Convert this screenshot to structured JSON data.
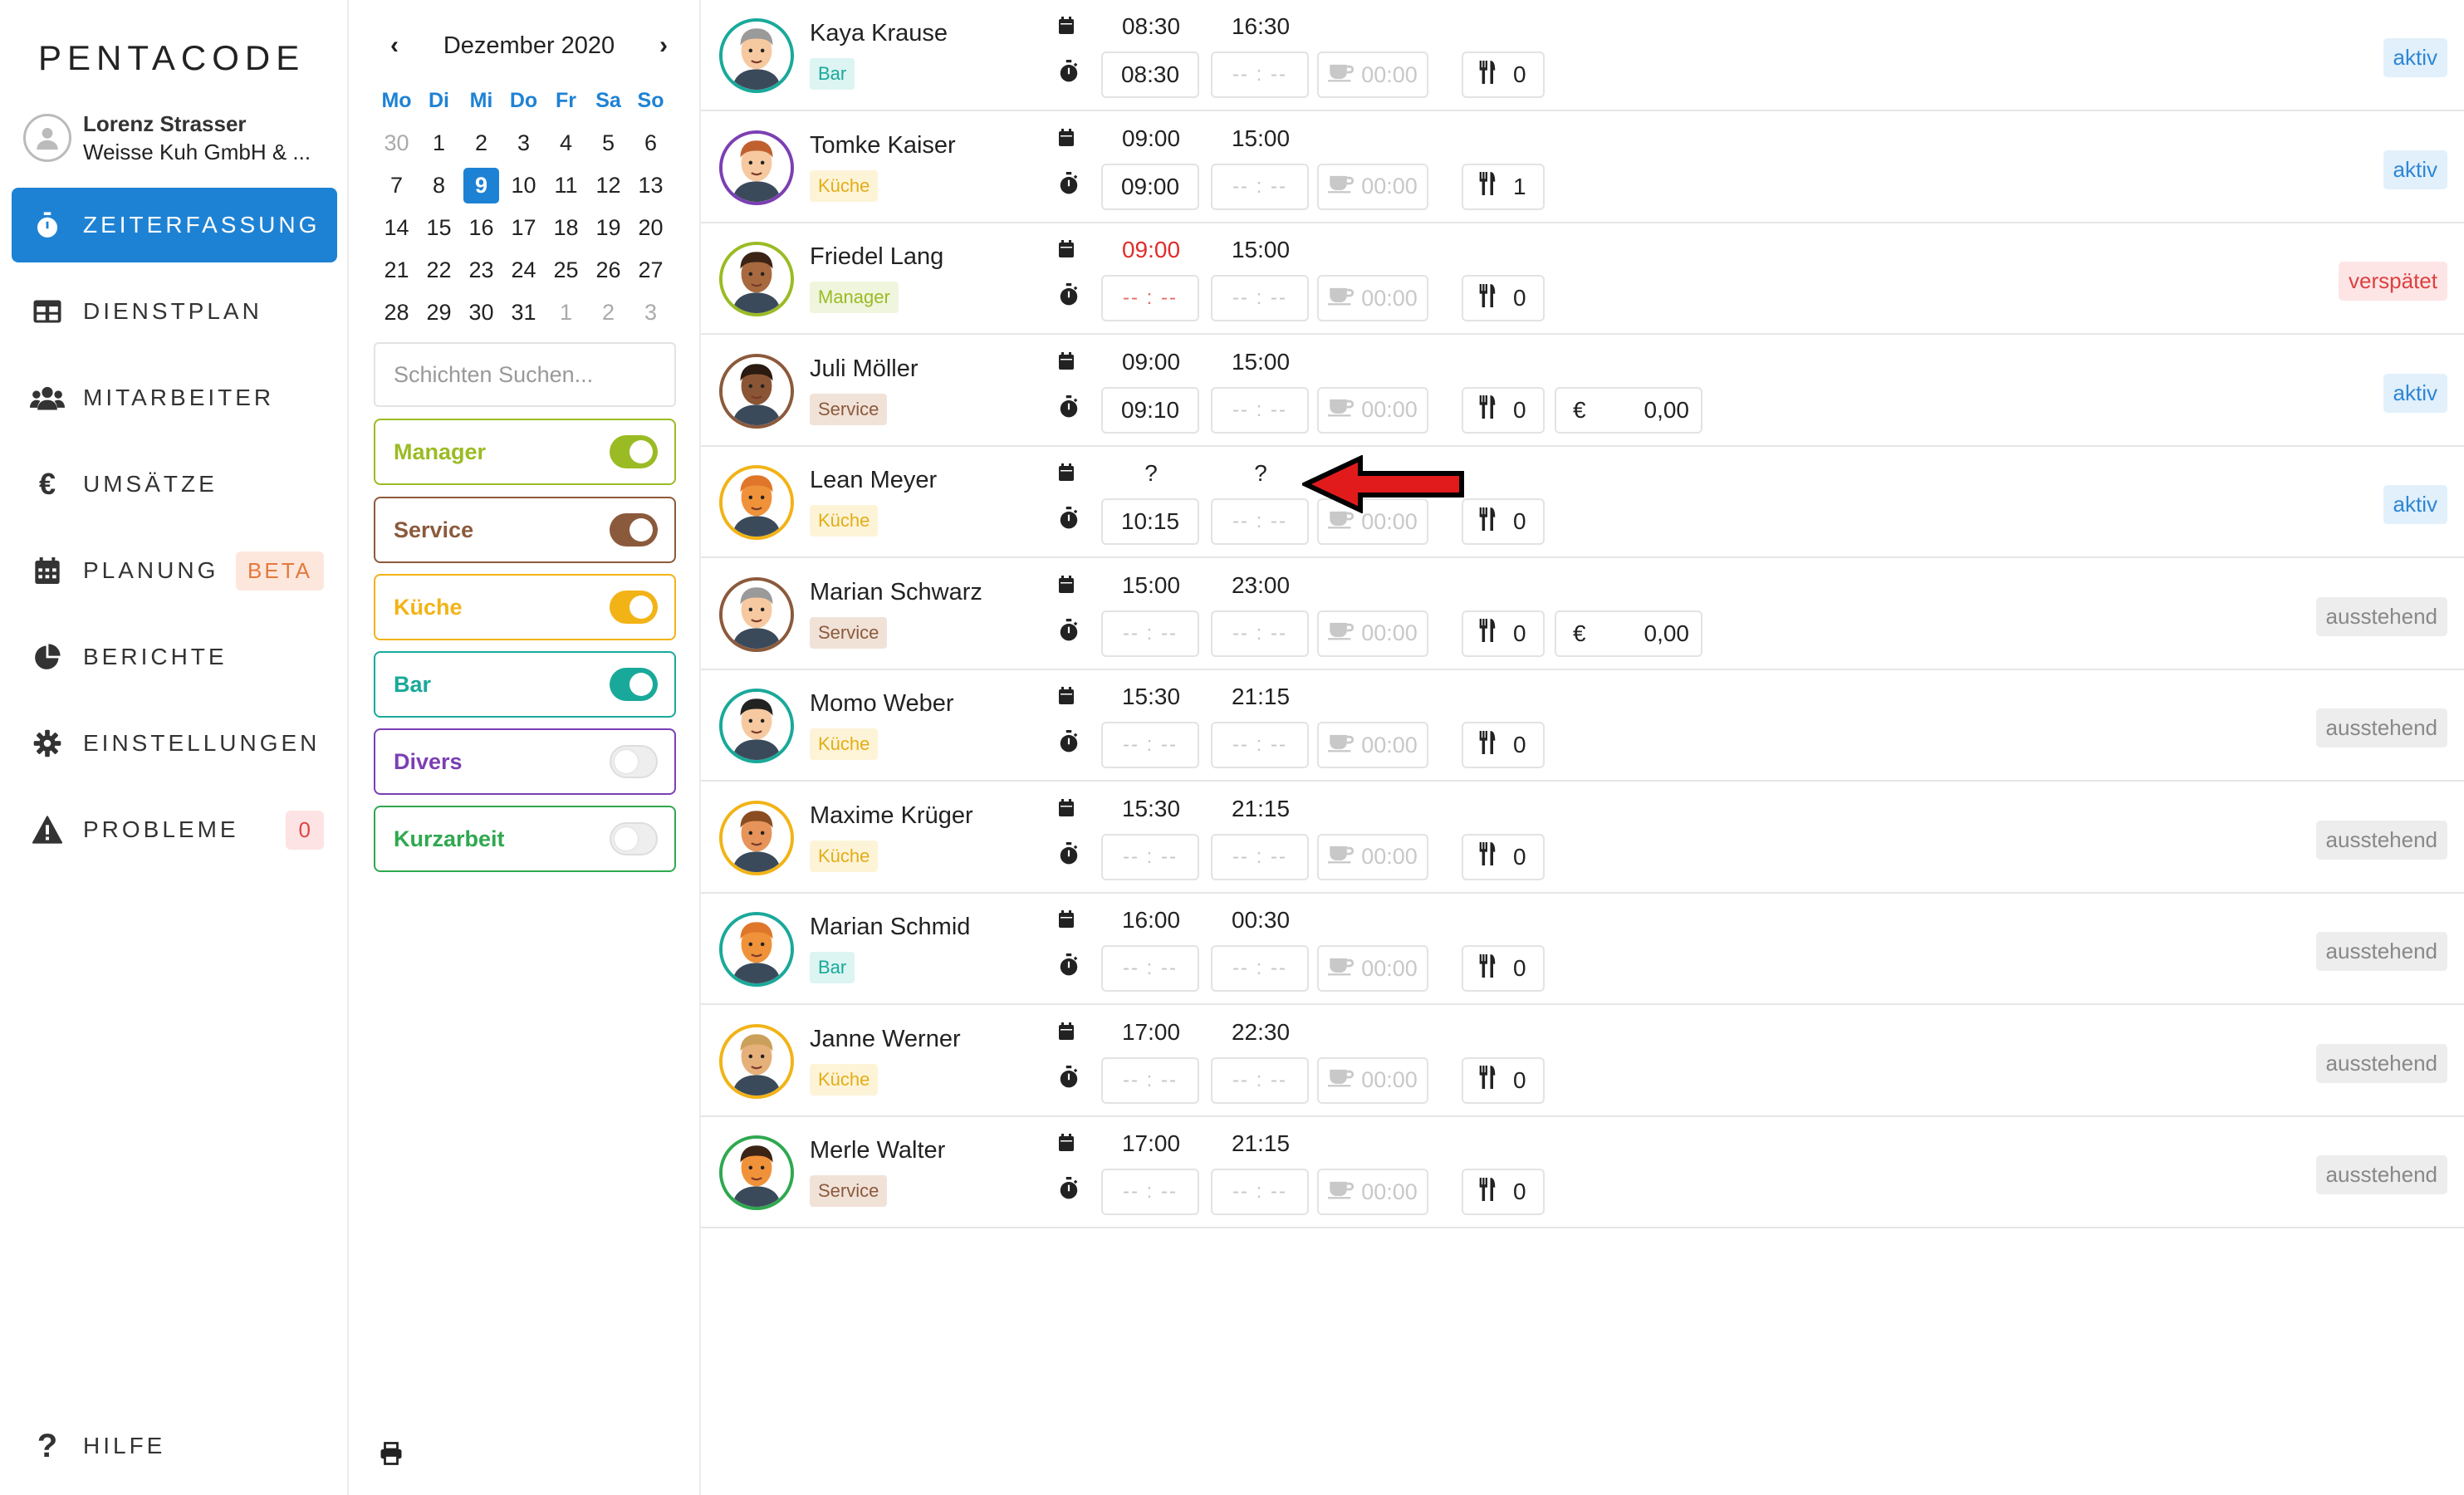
{
  "app": {
    "logo": "PENTACODE"
  },
  "user": {
    "name": "Lorenz Strasser",
    "company": "Weisse Kuh GmbH & ..."
  },
  "nav": [
    {
      "label": "ZEITERFASSUNG",
      "icon": "stopwatch-icon",
      "active": true
    },
    {
      "label": "DIENSTPLAN",
      "icon": "table-icon"
    },
    {
      "label": "MITARBEITER",
      "icon": "users-icon"
    },
    {
      "label": "UMSÄTZE",
      "icon": "euro-icon"
    },
    {
      "label": "PLANUNG",
      "icon": "calendar-icon",
      "badge": "BETA"
    },
    {
      "label": "BERICHTE",
      "icon": "pie-chart-icon"
    },
    {
      "label": "EINSTELLUNGEN",
      "icon": "gear-icon"
    },
    {
      "label": "PROBLEME",
      "icon": "warning-icon",
      "badge": "0"
    }
  ],
  "help": {
    "label": "HILFE",
    "icon": "question-icon"
  },
  "calendar": {
    "title": "Dezember 2020",
    "weekdays": [
      "Mo",
      "Di",
      "Mi",
      "Do",
      "Fr",
      "Sa",
      "So"
    ],
    "days": [
      "30",
      "1",
      "2",
      "3",
      "4",
      "5",
      "6",
      "7",
      "8",
      "9",
      "10",
      "11",
      "12",
      "13",
      "14",
      "15",
      "16",
      "17",
      "18",
      "19",
      "20",
      "21",
      "22",
      "23",
      "24",
      "25",
      "26",
      "27",
      "28",
      "29",
      "30",
      "31",
      "1",
      "2",
      "3"
    ],
    "selected": "9"
  },
  "search": {
    "placeholder": "Schichten Suchen..."
  },
  "filters": [
    {
      "label": "Manager",
      "color": "#9bbb24",
      "on": true
    },
    {
      "label": "Service",
      "color": "#8b5a3c",
      "on": true
    },
    {
      "label": "Küche",
      "color": "#f2b316",
      "on": true
    },
    {
      "label": "Bar",
      "color": "#19a99a",
      "on": true
    },
    {
      "label": "Divers",
      "color": "#7b3fb3",
      "on": false
    },
    {
      "label": "Kurzarbeit",
      "color": "#2fa84f",
      "on": false
    }
  ],
  "tag_colors": {
    "Bar": {
      "bg": "#dcf4f2",
      "fg": "#19a99a"
    },
    "Küche": {
      "bg": "#fdf4d8",
      "fg": "#e3ad17"
    },
    "Manager": {
      "bg": "#f0f5de",
      "fg": "#9bbb24"
    },
    "Service": {
      "bg": "#f1e2d8",
      "fg": "#8b5a3c"
    }
  },
  "rows": [
    {
      "name": "Kaya Krause",
      "tag": "Bar",
      "plan_start": "08:30",
      "plan_end": "16:30",
      "start": "08:30",
      "end": "-- : --",
      "pause": "00:00",
      "meals": "0",
      "status": "aktiv",
      "ring": "#19a99a",
      "skin": "#f6c9a0",
      "hair": "#9a9a9a"
    },
    {
      "name": "Tomke Kaiser",
      "tag": "Küche",
      "plan_start": "09:00",
      "plan_end": "15:00",
      "start": "09:00",
      "end": "-- : --",
      "pause": "00:00",
      "meals": "1",
      "status": "aktiv",
      "ring": "#7b3fb3",
      "skin": "#f6c9a0",
      "hair": "#c0602f"
    },
    {
      "name": "Friedel Lang",
      "tag": "Manager",
      "plan_start": "09:00",
      "plan_end": "15:00",
      "start": "-- : --",
      "end": "-- : --",
      "pause": "00:00",
      "meals": "0",
      "status": "verspätet",
      "late": true,
      "ring": "#9bbb24",
      "skin": "#a8693f",
      "hair": "#3b2415"
    },
    {
      "name": "Juli Möller",
      "tag": "Service",
      "plan_start": "09:00",
      "plan_end": "15:00",
      "start": "09:10",
      "end": "-- : --",
      "pause": "00:00",
      "meals": "0",
      "money": "0,00",
      "status": "aktiv",
      "ring": "#8b5a3c",
      "skin": "#8a5534",
      "hair": "#2a1a10"
    },
    {
      "name": "Lean Meyer",
      "tag": "Küche",
      "plan_start": "?",
      "plan_end": "?",
      "start": "10:15",
      "end": "-- : --",
      "pause": "00:00",
      "meals": "0",
      "status": "aktiv",
      "ring": "#f2b316",
      "skin": "#f0923a",
      "hair": "#e0762a"
    },
    {
      "name": "Marian Schwarz",
      "tag": "Service",
      "plan_start": "15:00",
      "plan_end": "23:00",
      "start": "-- : --",
      "end": "-- : --",
      "pause": "00:00",
      "meals": "0",
      "money": "0,00",
      "status": "ausstehend",
      "ring": "#8b5a3c",
      "skin": "#f6c9a0",
      "hair": "#9a9a9a"
    },
    {
      "name": "Momo Weber",
      "tag": "Küche",
      "plan_start": "15:30",
      "plan_end": "21:15",
      "start": "-- : --",
      "end": "-- : --",
      "pause": "00:00",
      "meals": "0",
      "status": "ausstehend",
      "ring": "#19a99a",
      "skin": "#f6c9a0",
      "hair": "#222222"
    },
    {
      "name": "Maxime Krüger",
      "tag": "Küche",
      "plan_start": "15:30",
      "plan_end": "21:15",
      "start": "-- : --",
      "end": "-- : --",
      "pause": "00:00",
      "meals": "0",
      "status": "ausstehend",
      "ring": "#f2b316",
      "skin": "#e6945a",
      "hair": "#8a4d22"
    },
    {
      "name": "Marian Schmid",
      "tag": "Bar",
      "plan_start": "16:00",
      "plan_end": "00:30",
      "start": "-- : --",
      "end": "-- : --",
      "pause": "00:00",
      "meals": "0",
      "status": "ausstehend",
      "ring": "#19a99a",
      "skin": "#f0923a",
      "hair": "#e0762a"
    },
    {
      "name": "Janne Werner",
      "tag": "Küche",
      "plan_start": "17:00",
      "plan_end": "22:30",
      "start": "-- : --",
      "end": "-- : --",
      "pause": "00:00",
      "meals": "0",
      "status": "ausstehend",
      "ring": "#f2b316",
      "skin": "#e6b07a",
      "hair": "#caa05a"
    },
    {
      "name": "Merle Walter",
      "tag": "Service",
      "plan_start": "17:00",
      "plan_end": "21:15",
      "start": "-- : --",
      "end": "-- : --",
      "pause": "00:00",
      "meals": "0",
      "status": "ausstehend",
      "ring": "#2fa84f",
      "skin": "#f0923a",
      "hair": "#3b2415"
    }
  ]
}
